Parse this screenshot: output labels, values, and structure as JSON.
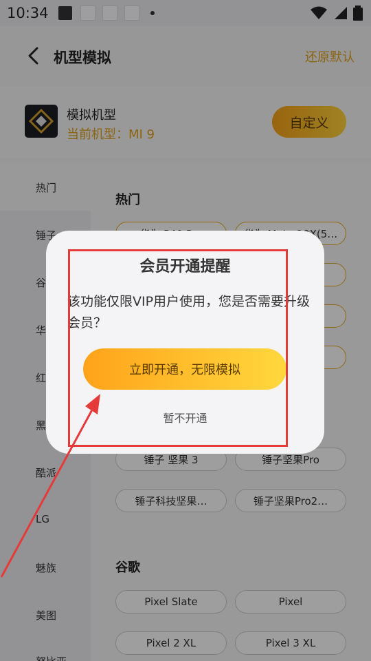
{
  "status_bar": {
    "time": "10:34"
  },
  "header": {
    "title": "机型模拟",
    "restore_label": "还原默认"
  },
  "device": {
    "name": "模拟机型",
    "current": "当前机型：MI 9",
    "custom_label": "自定义"
  },
  "categories": [
    "热门",
    "锤子",
    "谷",
    "华",
    "红",
    "黑",
    "酷派",
    "LG",
    "魅族",
    "美图",
    "努比亚"
  ],
  "sections": {
    "hot": {
      "title": "热门",
      "items": [
        "华为 P40 Pro",
        "华为 Mate 20X(5…",
        "",
        "",
        "",
        "",
        "",
        ""
      ]
    },
    "hammer": {
      "items": [
        "锤子 坚果 3",
        "锤子坚果Pro",
        "锤子科技坚果…",
        "锤子坚果Pro2…"
      ]
    },
    "google": {
      "title": "谷歌",
      "items": [
        "Pixel Slate",
        "Pixel",
        "Pixel 2 XL",
        "Pixel 3 XL"
      ]
    }
  },
  "dialog": {
    "title": "会员开通提醒",
    "message": "该功能仅限VIP用户使用，您是否需要升级会员？",
    "primary_label": "立即开通，无限模拟",
    "secondary_label": "暂不开通"
  },
  "colors": {
    "accent": "#e2a21b",
    "annotation": "#e53a3a"
  }
}
